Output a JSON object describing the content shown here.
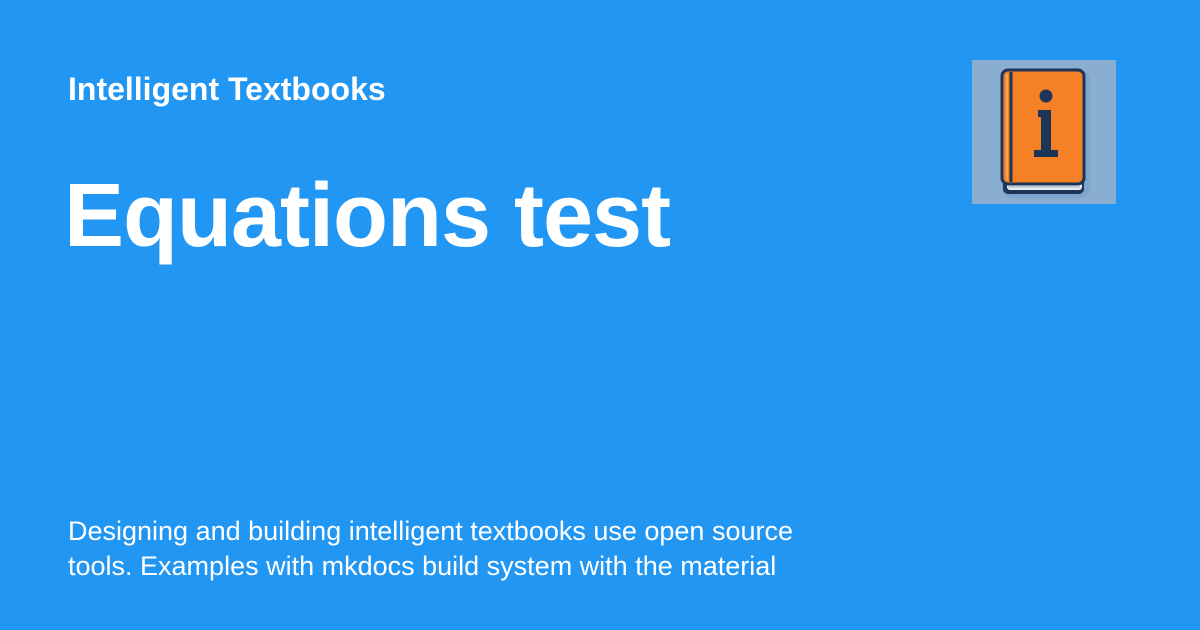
{
  "site": {
    "name": "Intelligent Textbooks"
  },
  "page": {
    "title": "Equations test",
    "description": "Designing and building intelligent textbooks use open source\ntools.  Examples with mkdocs build system with the material"
  },
  "logo": {
    "icon": "book-info-icon",
    "glyph": "i"
  },
  "colors": {
    "background": "#2196f3",
    "text": "#ffffff",
    "book_cover": "#f58025",
    "book_edge": "#1d3557",
    "logo_background": "#8aaed0"
  }
}
